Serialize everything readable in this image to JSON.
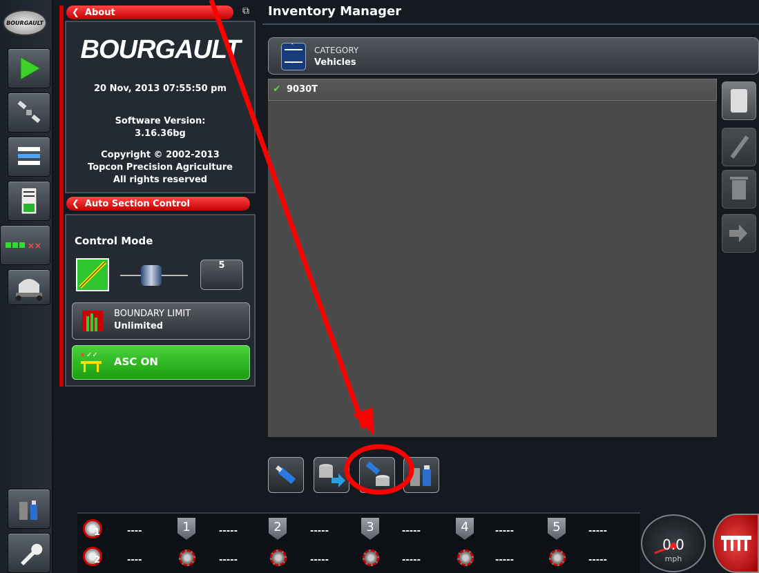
{
  "sidebar": {
    "logo_text": "BOURGAULT",
    "items": [
      {
        "name": "play-icon"
      },
      {
        "name": "satellite-icon"
      },
      {
        "name": "list-icon"
      },
      {
        "name": "calculator-icon"
      },
      {
        "name": "sections-icon"
      },
      {
        "name": "cart-icon"
      },
      {
        "name": "usb-inventory-icon"
      },
      {
        "name": "wrench-icon"
      }
    ]
  },
  "about": {
    "header": "About",
    "brand": "BOURGAULT",
    "datetime": "20 Nov, 2013  07:55:50 pm",
    "software_label": "Software Version:",
    "software_version": "3.16.36bg",
    "copyright": "Copyright © 2002-2013",
    "company": "Topcon Precision Agriculture",
    "rights": "All rights reserved"
  },
  "asc": {
    "header": "Auto Section Control",
    "control_mode_label": "Control Mode",
    "mode_value": "5",
    "boundary_label": "BOUNDARY LIMIT",
    "boundary_value": "Unlimited",
    "asc_button": "ASC ON"
  },
  "main": {
    "title": "Inventory Manager",
    "category_label": "CATEGORY",
    "category_value": "Vehicles",
    "items": [
      {
        "label": "9030T",
        "selected": true
      }
    ]
  },
  "status": {
    "rows": [
      {
        "first": "----",
        "sections": [
          "-----",
          "-----",
          "-----",
          "-----",
          "-----"
        ]
      },
      {
        "first": "----",
        "sections": [
          "-----",
          "-----",
          "-----",
          "-----",
          "-----"
        ]
      }
    ],
    "section_numbers": [
      "1",
      "2",
      "3",
      "4",
      "5"
    ],
    "row_labels": [
      "1",
      "2"
    ],
    "speed_value": "0.0",
    "speed_unit": "mph"
  },
  "colors": {
    "accent_red": "#c80000",
    "asc_green": "#1b9e10",
    "annotation_red": "#ff0000"
  }
}
